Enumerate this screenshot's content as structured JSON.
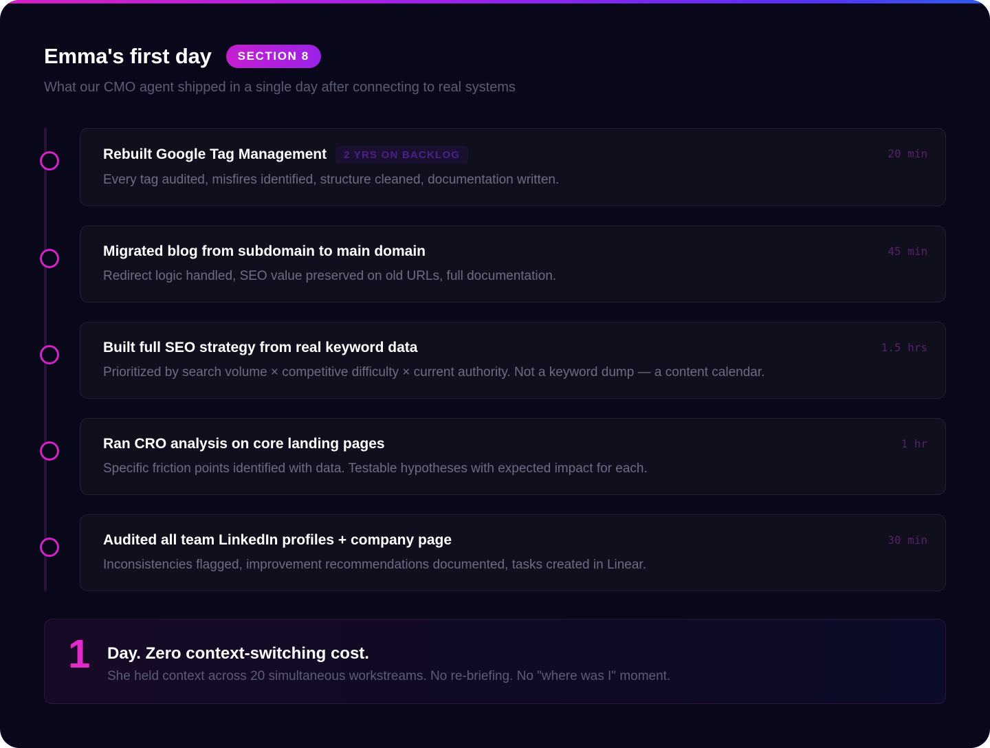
{
  "header": {
    "title": "Emma's first day",
    "section_badge": "SECTION 8",
    "subtitle": "What our CMO agent shipped in a single day after connecting to real systems"
  },
  "timeline": {
    "items": [
      {
        "title": "Rebuilt Google Tag Management",
        "badge": "2 YRS ON BACKLOG",
        "description": "Every tag audited, misfires identified, structure cleaned, documentation written.",
        "duration": "20 min"
      },
      {
        "title": "Migrated blog from subdomain to main domain",
        "description": "Redirect logic handled, SEO value preserved on old URLs, full documentation.",
        "duration": "45 min"
      },
      {
        "title": "Built full SEO strategy from real keyword data",
        "description": "Prioritized by search volume × competitive difficulty × current authority. Not a keyword dump — a content calendar.",
        "duration": "1.5 hrs"
      },
      {
        "title": "Ran CRO analysis on core landing pages",
        "description": "Specific friction points identified with data. Testable hypotheses with expected impact for each.",
        "duration": "1 hr"
      },
      {
        "title": "Audited all team LinkedIn profiles + company page",
        "description": "Inconsistencies flagged, improvement recommendations documented, tasks created in Linear.",
        "duration": "30 min"
      }
    ]
  },
  "summary": {
    "number": "1",
    "title": "Day. Zero context-switching cost.",
    "description": "She held context across 20 simultaneous workstreams. No re-briefing. No \"where was I\" moment."
  },
  "colors": {
    "background": "#08081a",
    "accent": "#d223c5",
    "card": "#0f0f1e"
  }
}
